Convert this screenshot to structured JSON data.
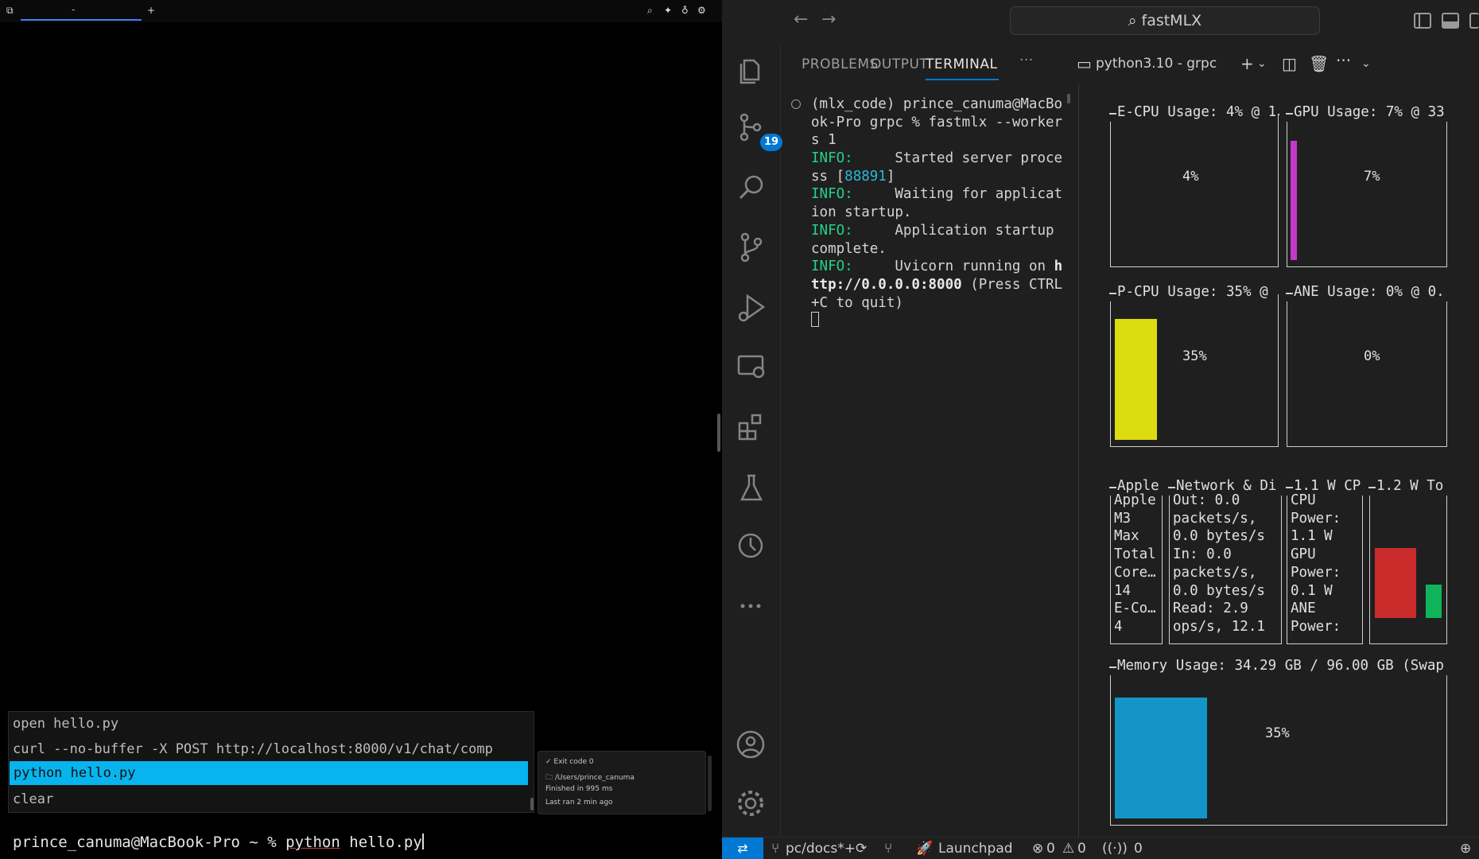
{
  "left_terminal": {
    "tab_label": "-",
    "new_tab": "+",
    "history": [
      "open hello.py",
      "curl --no-buffer -X POST http://localhost:8000/v1/chat/comp",
      "python hello.py",
      "clear"
    ],
    "meta": {
      "exit_code": "✓ Exit code 0",
      "dir": "🗀 /Users/prince_canuma",
      "finished": "Finished in 995 ms",
      "last_ran": "Last ran 2 min ago"
    },
    "prompt": "prince_canuma@MacBook-Pro ~ % ",
    "command": "python",
    "command_arg": " hello.py"
  },
  "vscode": {
    "command_center": "fastMLX",
    "scm_badge": "19",
    "panel_tabs": [
      "PROBLEMS",
      "OUTPUT",
      "TERMINAL"
    ],
    "more": "···",
    "terminal_name": "python3.10 - grpc",
    "terminal_lines": {
      "l1": "(mlx_code) prince_canuma@MacBo",
      "l2": "ok-Pro grpc % fastmlx --worker",
      "l3": "s 1",
      "info": "INFO:",
      "l4": "     Started server proce",
      "l5a": "ss [",
      "pid": "88891",
      "l5b": "]",
      "l6": "     Waiting for applicat",
      "l7": "ion startup.",
      "l8": "     Application startup",
      "l9": "complete.",
      "l10": "     Uvicorn running on ",
      "l10b": "h",
      "l11a": "ttp://0.0.0.0:8000",
      "l11b": " (Press CTRL",
      "l12": "+C to quit)"
    },
    "asitop": {
      "ecpu_title": "E-CPU Usage: 4% @ 1",
      "ecpu_pct": "4%",
      "gpu_title": "GPU Usage: 7% @ 33",
      "gpu_pct": "7%",
      "pcpu_title": "P-CPU Usage: 35% @",
      "pcpu_pct": "35%",
      "ane_title": "ANE Usage: 0% @ 0.",
      "ane_pct": "0%",
      "apple_title": "Apple",
      "apple_text": "Apple\nM3\nMax\nTotal\nCore…\n14\nE-Co…\n4",
      "net_title": "Network & Di",
      "net_text": "Out: 0.0\npackets/s,\n0.0 bytes/s\nIn: 0.0\npackets/s,\n0.0 bytes/s\nRead: 2.9\nops/s, 12.1",
      "power_title": "1.1 W CP",
      "power_text": "CPU\nPower:\n1.1 W\nGPU\nPower:\n0.1 W\nANE\nPower:",
      "total_title": "1.2 W To",
      "mem_title": "Memory Usage: 34.29 GB / 96.00 GB (Swap",
      "mem_pct": "35%"
    },
    "levels": {
      "ecpu": 0.04,
      "gpu": 0.07,
      "pcpu": 0.35,
      "ane": 0.0,
      "mem": 0.35
    },
    "colors": {
      "gpu": "#c238c9",
      "pcpu": "#dcdc10",
      "mem": "#1396c7",
      "power_red": "#c92a2a",
      "power_green": "#0fb45a",
      "accent": "#0078d4"
    },
    "status": {
      "branch": "pc/docs*+",
      "launchpad": "Launchpad",
      "errors": "0",
      "warnings": "0",
      "ports": "0"
    }
  }
}
